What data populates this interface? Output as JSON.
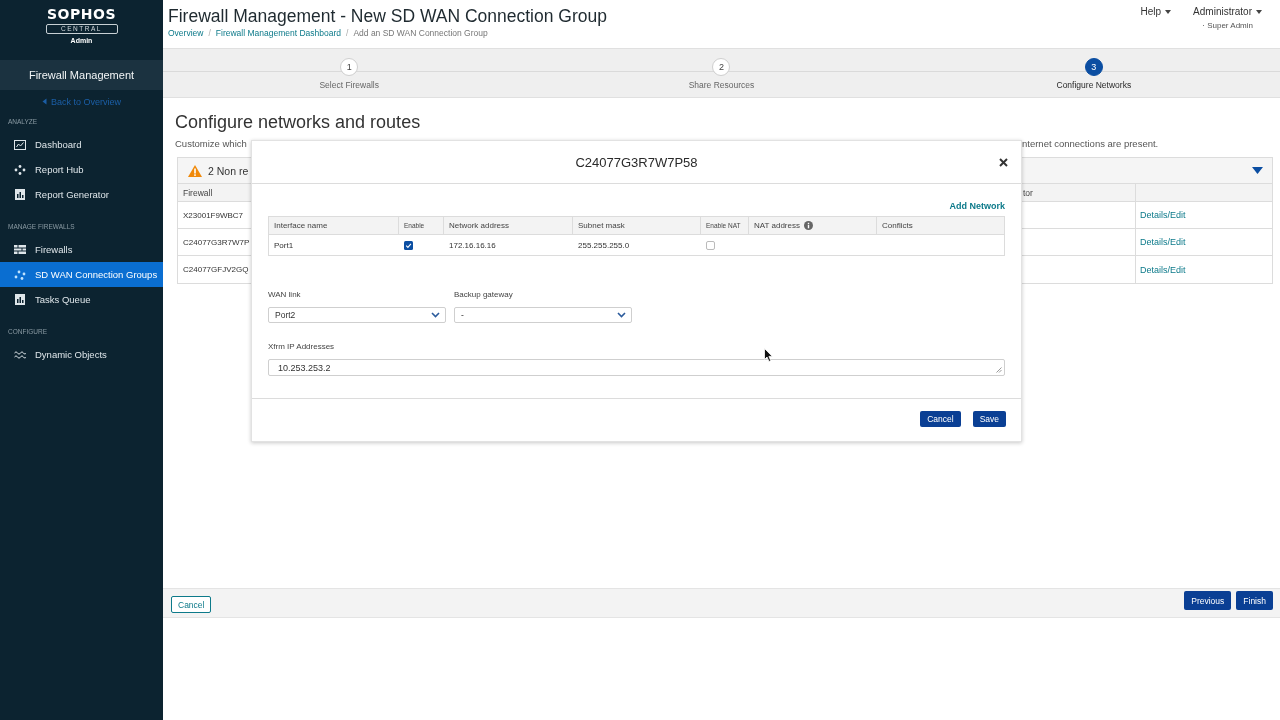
{
  "sidebar": {
    "logo": {
      "brand": "SOPHOS",
      "product": "CENTRAL",
      "role": "Admin"
    },
    "app_title": "Firewall Management",
    "back_link": "Back to Overview",
    "sections": [
      {
        "heading": "ANALYZE",
        "items": [
          {
            "label": "Dashboard",
            "selected": false
          },
          {
            "label": "Report Hub",
            "selected": false
          },
          {
            "label": "Report Generator",
            "selected": false
          }
        ]
      },
      {
        "heading": "MANAGE FIREWALLS",
        "items": [
          {
            "label": "Firewalls",
            "selected": false
          },
          {
            "label": "SD WAN Connection Groups",
            "selected": true
          },
          {
            "label": "Tasks Queue",
            "selected": false
          }
        ]
      },
      {
        "heading": "CONFIGURE",
        "items": [
          {
            "label": "Dynamic Objects",
            "selected": false
          }
        ]
      }
    ]
  },
  "header": {
    "title": "Firewall Management - New SD WAN Connection Group",
    "breadcrumb": [
      {
        "kind": "link",
        "text": "Overview"
      },
      {
        "kind": "separator",
        "text": "/"
      },
      {
        "kind": "link",
        "text": "Firewall Management Dashboard"
      },
      {
        "kind": "separator",
        "text": "/"
      },
      {
        "kind": "current",
        "text": "Add an SD WAN Connection Group"
      }
    ],
    "help_menu": "Help",
    "user_menu": "Administrator",
    "user_role": "· Super Admin"
  },
  "stepper": [
    {
      "number": "1",
      "label": "Select Firewalls",
      "selected": false
    },
    {
      "number": "2",
      "label": "Share Resources",
      "selected": false
    },
    {
      "number": "3",
      "label": "Configure Networks",
      "selected": true
    }
  ],
  "page": {
    "heading": "Configure networks and routes",
    "description_fragments": [
      "Customize which",
      "nternet connections are present."
    ],
    "warning_banner": {
      "text": "2 Non re"
    },
    "firewall_table": {
      "columns": [
        "Firewall",
        "tor"
      ],
      "rows": [
        {
          "firewall": "X23001F9WBC7",
          "action": "Details/Edit"
        },
        {
          "firewall": "C24077G3R7W7P",
          "action": "Details/Edit"
        },
        {
          "firewall": "C24077GFJV2GQ",
          "action": "Details/Edit"
        }
      ]
    }
  },
  "modal": {
    "title": "C24077G3R7W7P58",
    "add_network": "Add Network",
    "columns": [
      {
        "label": "Interface name",
        "small": false,
        "info": false
      },
      {
        "label": "Enable",
        "small": true,
        "info": false
      },
      {
        "label": "Network address",
        "small": false,
        "info": false
      },
      {
        "label": "Subnet mask",
        "small": false,
        "info": false
      },
      {
        "label": "Enable NAT",
        "small": true,
        "info": false
      },
      {
        "label": "NAT address",
        "small": false,
        "info": true
      },
      {
        "label": "Conflicts",
        "small": false,
        "info": false
      }
    ],
    "rows": [
      {
        "interface_name": "Port1",
        "enabled": true,
        "network_address": "172.16.16.16",
        "subnet_mask": "255.255.255.0",
        "nat_enabled": false
      }
    ],
    "wan_link": {
      "label": "WAN link",
      "value": "Port2"
    },
    "backup_gateway": {
      "label": "Backup gateway",
      "value": "-"
    },
    "xfrm_ip": {
      "label": "Xfrm IP Addresses",
      "value": "10.253.253.2"
    },
    "buttons": [
      {
        "label": "Cancel"
      },
      {
        "label": "Save"
      }
    ]
  },
  "footer": {
    "cancel": "Cancel",
    "previous": "Previous",
    "finish": "Finish"
  }
}
